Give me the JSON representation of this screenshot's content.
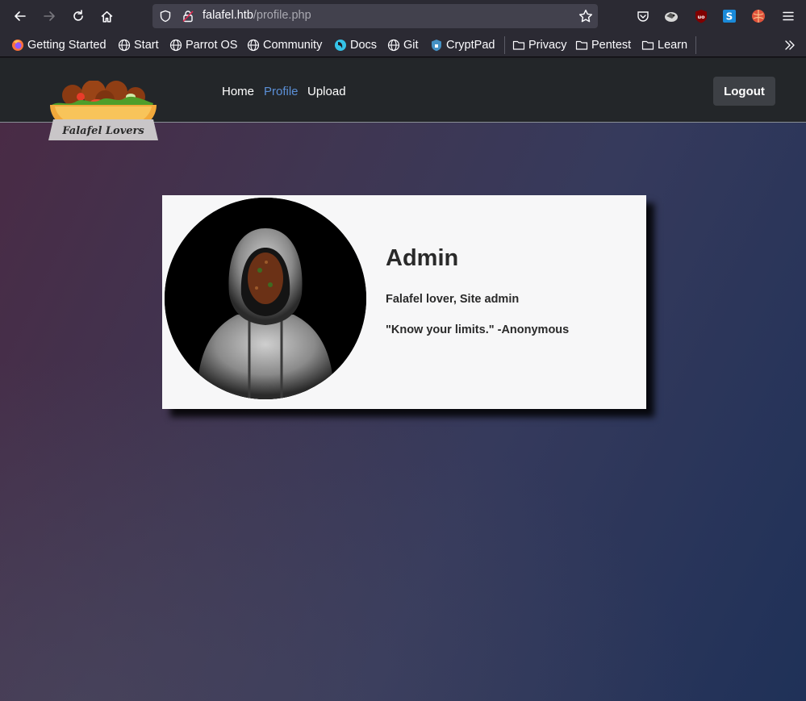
{
  "browser": {
    "url_host": "falafel.htb",
    "url_path": "/profile.php",
    "bookmarks": [
      {
        "label": "Getting Started",
        "icon": "firefox-icon"
      },
      {
        "label": "Start",
        "icon": "globe-icon"
      },
      {
        "label": "Parrot OS",
        "icon": "globe-icon"
      },
      {
        "label": "Community",
        "icon": "globe-icon"
      },
      {
        "label": "Docs",
        "icon": "parrot-icon"
      },
      {
        "label": "Git",
        "icon": "globe-icon"
      },
      {
        "label": "CryptPad",
        "icon": "cryptpad-icon"
      },
      {
        "label": "Privacy",
        "icon": "folder-icon"
      },
      {
        "label": "Pentest",
        "icon": "folder-icon"
      },
      {
        "label": "Learn",
        "icon": "folder-icon"
      }
    ]
  },
  "site": {
    "logo_text": "Falafel Lovers",
    "nav": [
      {
        "label": "Home",
        "active": false
      },
      {
        "label": "Profile",
        "active": true
      },
      {
        "label": "Upload",
        "active": false
      }
    ],
    "logout_label": "Logout",
    "accent_color": "#5b8fd6"
  },
  "profile": {
    "name": "Admin",
    "role": "Falafel lover, Site admin",
    "quote": "\"Know your limits.\" -Anonymous"
  }
}
